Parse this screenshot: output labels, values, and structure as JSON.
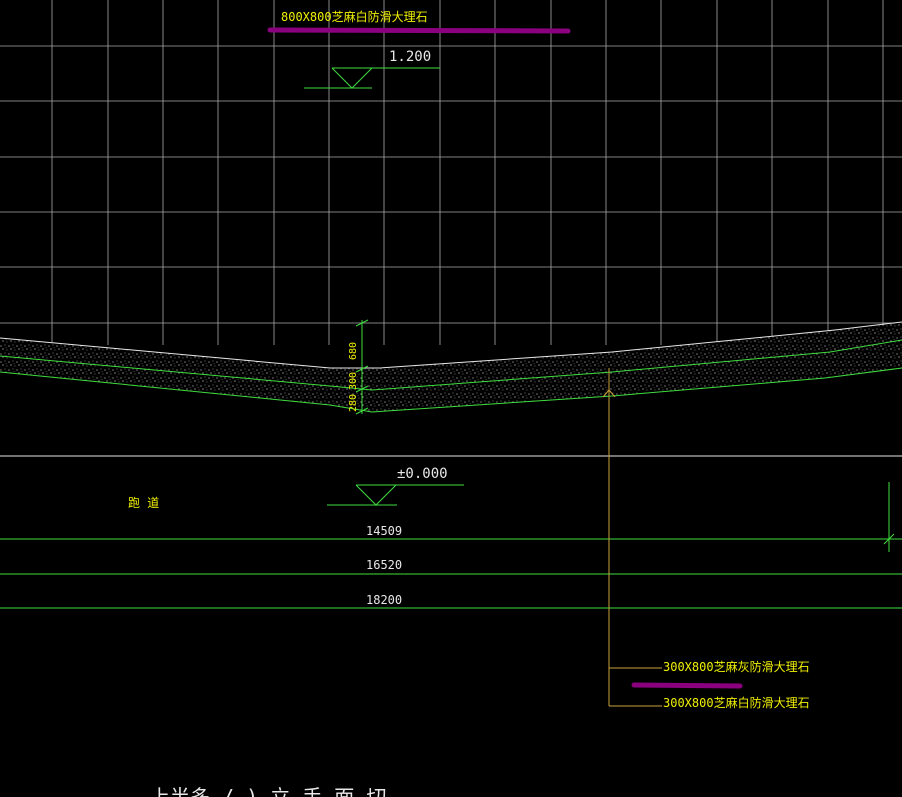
{
  "labels": {
    "top_material": "800X800芝麻白防滑大理石",
    "elev_top": "1.200",
    "elev_zero": "±0.000",
    "runway": "跑 道",
    "dim_a": "680",
    "dim_b": "300",
    "dim_c": "280",
    "line_1": "14509",
    "line_2": "16520",
    "line_3": "18200",
    "callout_1": "300X800芝麻灰防滑大理石",
    "callout_2": "300X800芝麻白防滑大理石",
    "bottom_partial": "上半多 / ) 立 手 面 切"
  },
  "colors": {
    "background": "#000000",
    "grid": "#c8c8c8",
    "green": "#3fdc3f",
    "yellow": "#f0f000",
    "white_text": "#e8e8e8",
    "highlight": "#8a007f",
    "leader": "#c9a23a"
  }
}
